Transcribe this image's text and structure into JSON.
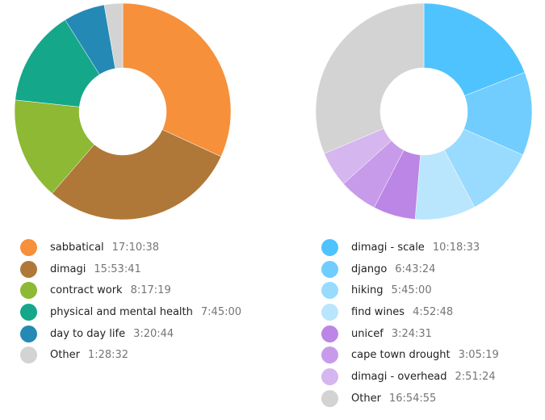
{
  "chart_data": [
    {
      "type": "pie",
      "title": "",
      "categories": [
        "sabbatical",
        "dimagi",
        "contract work",
        "physical and mental health",
        "day to day life",
        "Other"
      ],
      "durations": [
        "17:10:38",
        "15:53:41",
        "8:17:19",
        "7:45:00",
        "3:20:44",
        "1:28:32"
      ],
      "values_seconds": [
        61838,
        57221,
        29839,
        27900,
        12044,
        5312
      ],
      "colors": [
        "#f6903b",
        "#b07838",
        "#8db934",
        "#15a78a",
        "#2589b5",
        "#d3d3d3"
      ],
      "donut": true,
      "legend": "bottom"
    },
    {
      "type": "pie",
      "title": "",
      "categories": [
        "dimagi - scale",
        "django",
        "hiking",
        "find wines",
        "unicef",
        "cape town drought",
        "dimagi - overhead",
        "Other"
      ],
      "durations": [
        "10:18:33",
        "6:43:24",
        "5:45:00",
        "4:52:48",
        "3:24:31",
        "3:05:19",
        "2:51:24",
        "16:54:55"
      ],
      "values_seconds": [
        37113,
        24204,
        20700,
        17568,
        12271,
        11119,
        10284,
        60895
      ],
      "colors": [
        "#4fc3fe",
        "#70cdfe",
        "#99dbfe",
        "#bae6fd",
        "#bb86e5",
        "#c79bea",
        "#d6b6ef",
        "#d3d3d3"
      ],
      "donut": true,
      "legend": "bottom"
    }
  ]
}
